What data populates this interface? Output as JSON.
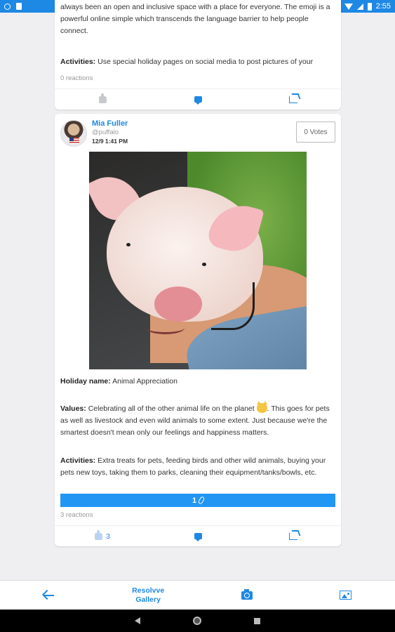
{
  "status_bar": {
    "time": "2:55"
  },
  "post1": {
    "text_top": "always been an open and inclusive space with a place for everyone. The emoji is a powerful online simple which transcends the language barrier to help people connect.",
    "activities_label": "Activities:",
    "activities_text": "Use special holiday pages on social media to post pictures of your",
    "reactions": "0 reactions"
  },
  "post2": {
    "user_name": "Mia Fuller",
    "user_handle": "@puffalo",
    "timestamp": "12/9 1:41 PM",
    "votes_label": "0 Votes",
    "holiday_label": "Holiday name:",
    "holiday_value": "Animal Appreciation",
    "values_label": "Values:",
    "values_text_a": "Celebrating all of the other animal life on the planet",
    "values_text_b": ". This goes for pets as well as livestock and even wild animals to some extent. Just because we're the smartest doesn't mean only our feelings and happiness matters.",
    "activities_label": "Activities:",
    "activities_text": "Extra treats for pets, feeding birds and other wild animals, buying your pets new toys, taking them to parks, cleaning their equipment/tanks/bowls, etc.",
    "attachments_count": "1",
    "reactions": "3 reactions",
    "like_count": "3"
  },
  "bottom_bar": {
    "resolve_label": "Resolvve Gallery"
  },
  "colors": {
    "accent": "#1e88e5",
    "attach_bar": "#2196f3"
  }
}
